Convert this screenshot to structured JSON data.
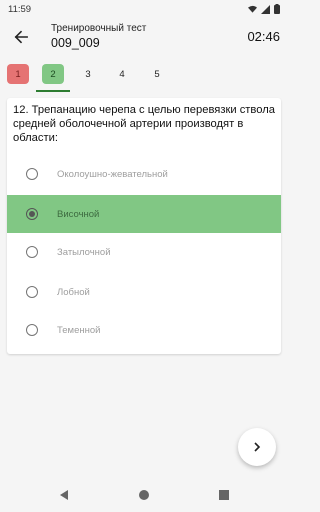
{
  "status_bar": {
    "time": "11:59",
    "icons": [
      "wifi-icon",
      "signal-icon",
      "battery-icon"
    ]
  },
  "app_bar": {
    "back_icon": "arrow-back-icon",
    "subtitle": "Тренировочный тест",
    "title": "009_009",
    "timer": "02:46"
  },
  "tabs": [
    {
      "label": "1",
      "state": "wrong"
    },
    {
      "label": "2",
      "state": "correct",
      "active": true
    },
    {
      "label": "3",
      "state": "none"
    },
    {
      "label": "4",
      "state": "none"
    },
    {
      "label": "5",
      "state": "none"
    }
  ],
  "question": {
    "text": "12. Трепанацию черепа с целью перевязки ствола средней оболочечной артерии производят в области:",
    "options": [
      {
        "label": "Околоушно-жевательной",
        "selected": false
      },
      {
        "label": "Височной",
        "selected": true
      },
      {
        "label": "Затылочной",
        "selected": false
      },
      {
        "label": "Лобной",
        "selected": false
      },
      {
        "label": "Теменной",
        "selected": false
      }
    ]
  },
  "next_button": {
    "icon": "chevron-right-icon"
  },
  "nav_bar": {
    "icons": [
      "nav-back-icon",
      "nav-home-icon",
      "nav-recents-icon"
    ]
  },
  "colors": {
    "correct": "#81c784",
    "wrong": "#e57373",
    "accent": "#2e7d32"
  }
}
